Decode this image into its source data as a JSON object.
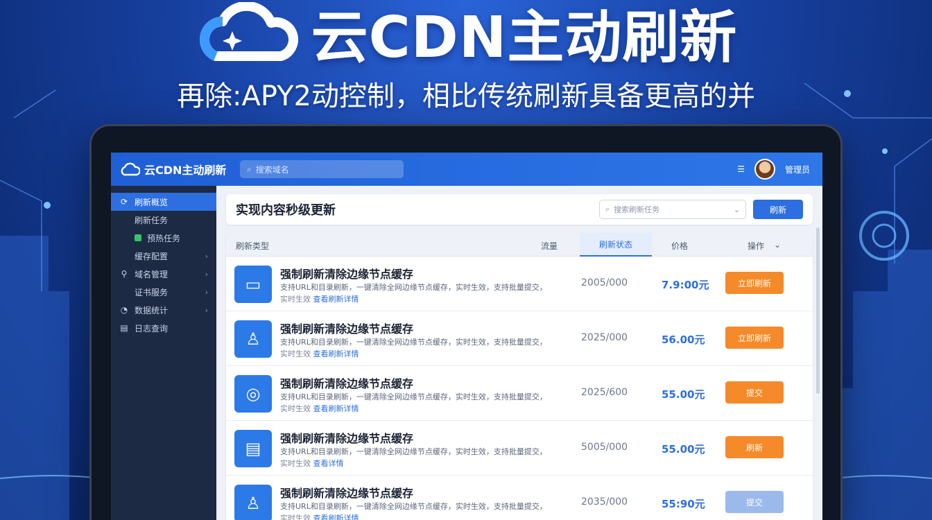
{
  "hero": {
    "title": "云CDN主动刷新",
    "subtitle": "再除:APY2动控制，相比传统刷新具备更高的并"
  },
  "app": {
    "brand": "云CDN主动刷新",
    "search_placeholder": "搜索域名",
    "user_name": "管理员"
  },
  "sidebar": {
    "items": [
      {
        "label": "刷新概览",
        "icon": "refresh-icon",
        "active": true
      },
      {
        "label": "刷新任务",
        "sub": true
      },
      {
        "label": "预热任务",
        "sub": true,
        "green": true
      },
      {
        "label": "缓存配置",
        "sub": true,
        "chev": "›"
      },
      {
        "label": "域名管理",
        "icon": "user-icon",
        "chev": "›"
      },
      {
        "label": "证书服务",
        "sub": true,
        "chev": "›"
      },
      {
        "label": "数据统计",
        "icon": "chart-icon",
        "chev": "›"
      },
      {
        "label": "日志查询",
        "icon": "log-icon"
      }
    ]
  },
  "panel": {
    "title": "实现内容秒级更新",
    "search_placeholder": "搜索刷新任务",
    "button": "刷新"
  },
  "table": {
    "headers": {
      "name": "刷新类型",
      "col2": "流量",
      "col3": "刷新状态",
      "col4": "价格",
      "col5": "操作"
    },
    "rows": [
      {
        "title": "强制刷新清除边缘节点缓存",
        "desc": "支持URL和目录刷新，一键清除全网边缘节点缓存，实时生效，支持批量提交，",
        "link_prefix": "实时生效",
        "link": "查看刷新详情",
        "date": "2005/000",
        "price": "7.9:00元",
        "button": "立即刷新",
        "disabled": false
      },
      {
        "title": "强制刷新清除边缘节点缓存",
        "desc": "支持URL和目录刷新，一键清除全网边缘节点缓存，实时生效，支持批量提交，",
        "link_prefix": "实时生效",
        "link": "查看刷新详情",
        "date": "2025/000",
        "price": "56.00元",
        "button": "立即刷新",
        "disabled": false
      },
      {
        "title": "强制刷新清除边缘节点缓存",
        "desc": "支持URL和目录刷新，一键清除全网边缘节点缓存，实时生效，支持批量提交，",
        "link_prefix": "实时生效",
        "link": "查看刷新详情",
        "date": "2025/600",
        "price": "55.00元",
        "button": "提交",
        "disabled": false
      },
      {
        "title": "强制刷新清除边缘节点缓存",
        "desc": "支持URL和目录刷新，一键清除全网边缘节点缓存，实时生效，支持批量提交，",
        "link_prefix": "实时生效",
        "link": "查看详情",
        "date": "5005/000",
        "price": "55.00元",
        "button": "刷新",
        "disabled": false
      },
      {
        "title": "强制刷新清除边缘节点缓存",
        "desc": "支持URL和目录刷新，一键清除全网边缘节点缓存，实时生效，支持批量提交，",
        "link_prefix": "实时生效",
        "link": "查看刷新详情",
        "date": "2035/000",
        "price": "55:90元",
        "button": "提交",
        "disabled": true
      }
    ]
  }
}
